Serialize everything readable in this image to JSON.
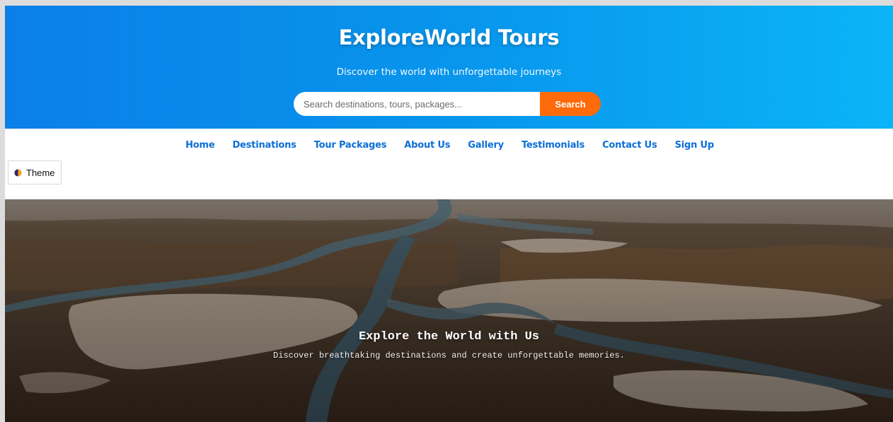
{
  "header": {
    "title": "ExploreWorld Tours",
    "tagline": "Discover the world with unforgettable journeys",
    "search": {
      "placeholder": "Search destinations, tours, packages...",
      "value": "",
      "button_label": "Search"
    },
    "colors": {
      "gradient_start": "#0a7fe8",
      "gradient_end": "#0bb4f7",
      "search_button": "#ff6a0a"
    }
  },
  "nav": {
    "items": [
      {
        "label": "Home",
        "name": "home"
      },
      {
        "label": "Destinations",
        "name": "destinations"
      },
      {
        "label": "Tour Packages",
        "name": "tour-packages"
      },
      {
        "label": "About Us",
        "name": "about-us"
      },
      {
        "label": "Gallery",
        "name": "gallery"
      },
      {
        "label": "Testimonials",
        "name": "testimonials"
      },
      {
        "label": "Contact Us",
        "name": "contact-us"
      },
      {
        "label": "Sign Up",
        "name": "sign-up"
      }
    ],
    "link_color": "#0b6fd6"
  },
  "theme_toggle": {
    "label": "Theme",
    "icon": "half-moon-icon"
  },
  "hero": {
    "title": "Explore the World with Us",
    "subtitle": "Discover breathtaking destinations and create unforgettable memories."
  }
}
